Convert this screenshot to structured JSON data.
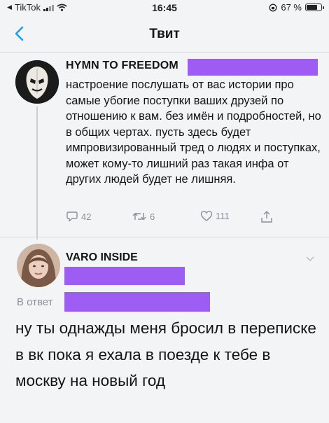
{
  "status_bar": {
    "back_app": "TikTok",
    "time": "16:45",
    "battery_percent": "67 %",
    "battery_level": 0.67
  },
  "nav": {
    "title": "Твит"
  },
  "tweet": {
    "author": "HYMN TO FREEDOM",
    "text": "настроение послушать от вас истории про самые убогие поступки ваших друзей по отношению к вам. без имён и подробностей, но в общих чертах. пусть здесь будет импровизированный тред о людях и поступках, может кому-то лишний раз такая инфа от других людей будет не лишняя.",
    "replies": "42",
    "retweets": "6",
    "likes": "111"
  },
  "reply": {
    "author": "VARO INSIDE",
    "reply_to_label": "В ответ",
    "text": "ну ты однажды меня бросил в переписке в вк пока я ехала в поезде к тебе в москву на новый год"
  },
  "colors": {
    "redaction": "#9d5cf2",
    "link_blue": "#1d9bf0",
    "muted": "#8a9099"
  },
  "icons": [
    "signal-icon",
    "wifi-icon",
    "battery-icon",
    "back-chevron-icon",
    "reply-icon",
    "retweet-icon",
    "like-icon",
    "share-icon",
    "chevron-down-icon"
  ]
}
